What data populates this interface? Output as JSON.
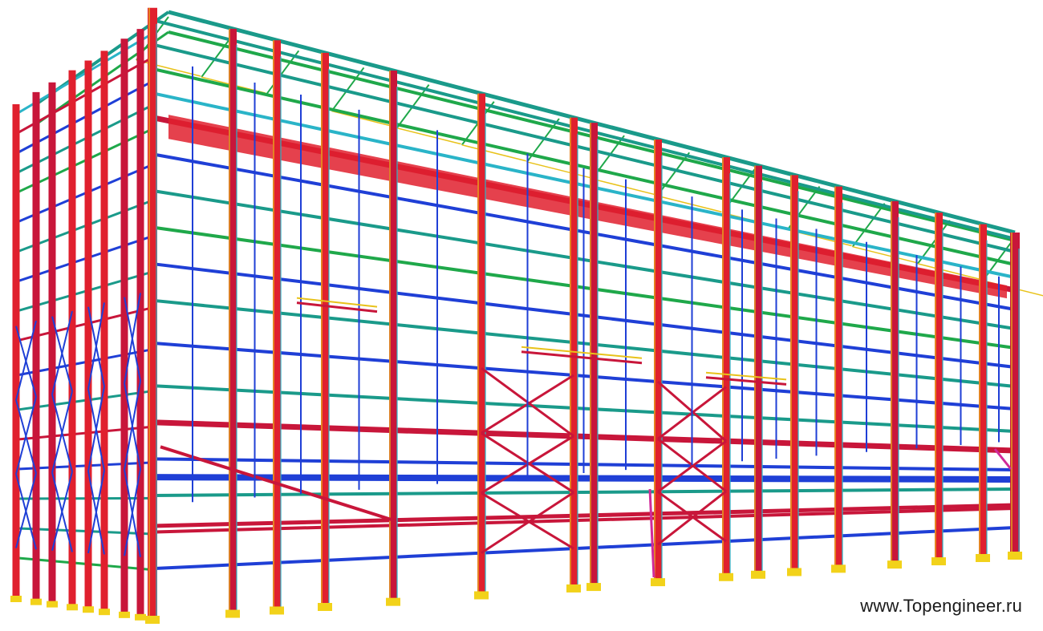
{
  "watermark": "www.Topengineer.ru",
  "image": {
    "subject": "3d-steel-frame",
    "palette": {
      "column": "#e0202e",
      "column_edge": "#b01722",
      "crimson": "#c8163a",
      "beam_blue": "#1f3fd6",
      "beam_green": "#1fa84a",
      "beam_teal": "#1a9a8a",
      "beam_cyan": "#2ab4c8",
      "base_plate": "#f2d21a",
      "bracing_yellow": "#e8c21a",
      "magenta": "#d02a9a",
      "background": "#ffffff"
    }
  }
}
